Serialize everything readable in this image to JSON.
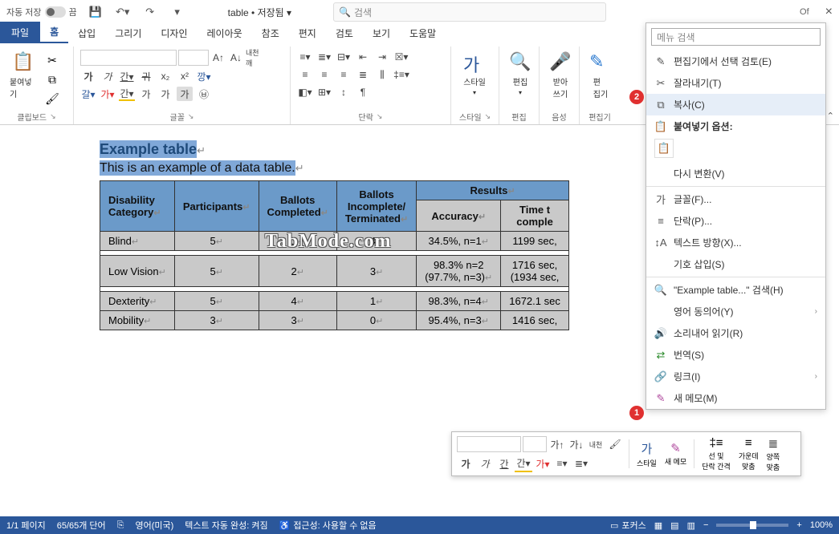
{
  "titlebar": {
    "autosave_label": "자동 저장",
    "autosave_state": "끔",
    "doc_title": "table • 저장됨 ▾",
    "search_placeholder": "검색",
    "office_label": "Of"
  },
  "tabs": {
    "file": "파일",
    "home": "홈",
    "insert": "삽입",
    "draw": "그리기",
    "design": "디자인",
    "layout": "레이아웃",
    "references": "참조",
    "mailings": "편지",
    "review": "검토",
    "view": "보기",
    "help": "도움말"
  },
  "ribbon": {
    "clipboard": {
      "label": "클립보드",
      "paste": "붙여넣기"
    },
    "font": {
      "label": "글꼴",
      "annotation": "내천 깨"
    },
    "paragraph": {
      "label": "단락"
    },
    "styles": {
      "label": "스타일",
      "button": "스타일"
    },
    "editing": {
      "label": "편집",
      "button": "편집"
    },
    "voice": {
      "label": "음성",
      "button": "받아\n쓰기"
    },
    "editor": {
      "label": "편집기",
      "button": "편\n집기"
    }
  },
  "document": {
    "heading": "Example table",
    "subtext": "This is an example of a data table.",
    "table": {
      "headers": {
        "category": "Disability\nCategory",
        "participants": "Participants",
        "ballots_completed": "Ballots\nCompleted",
        "ballots_incomplete": "Ballots\nIncomplete/\nTerminated",
        "results": "Results",
        "accuracy": "Accuracy",
        "time": "Time t\ncomple"
      },
      "rows": [
        {
          "cat": "Blind",
          "part": "5",
          "bc": "1",
          "bi": "4",
          "acc": "34.5%, n=1",
          "time": "1199 sec,"
        },
        {
          "cat": "Low Vision",
          "part": "5",
          "bc": "2",
          "bi": "3",
          "acc": "98.3% n=2\n(97.7%, n=3)",
          "time": "1716 sec,\n(1934 sec,"
        },
        {
          "cat": "Dexterity",
          "part": "5",
          "bc": "4",
          "bi": "1",
          "acc": "98.3%, n=4",
          "time": "1672.1 sec"
        },
        {
          "cat": "Mobility",
          "part": "3",
          "bc": "3",
          "bi": "0",
          "acc": "95.4%, n=3",
          "time": "1416 sec,"
        }
      ]
    }
  },
  "context_menu": {
    "search_placeholder": "메뉴 검색",
    "review_selection": "편집기에서 선택 검토(E)",
    "cut": "잘라내기(T)",
    "copy": "복사(C)",
    "paste_options_label": "붙여넣기 옵션:",
    "reconvert": "다시 변환(V)",
    "font": "글꼴(F)...",
    "paragraph": "단락(P)...",
    "text_direction": "텍스트 방향(X)...",
    "insert_symbol": "기호 삽입(S)",
    "search_web": "\"Example table...\" 검색(H)",
    "synonyms": "영어 동의어(Y)",
    "read_aloud": "소리내어 읽기(R)",
    "translate": "번역(S)",
    "link": "링크(I)",
    "new_comment": "새 메모(M)"
  },
  "mini_toolbar": {
    "styles": "스타일",
    "new_comment": "새 메모",
    "line_spacing": "선 및\n단락 간격",
    "center": "가운데\n맞춤",
    "justify": "양쪽\n맞춤"
  },
  "statusbar": {
    "page": "1/1 페이지",
    "words": "65/65개 단어",
    "language": "영어(미국)",
    "autocomplete": "텍스트 자동 완성: 켜짐",
    "accessibility": "접근성: 사용할 수 없음",
    "focus": "포커스",
    "zoom": "100%"
  },
  "watermark": "TabMode.com",
  "badges": {
    "one": "1",
    "two": "2"
  }
}
